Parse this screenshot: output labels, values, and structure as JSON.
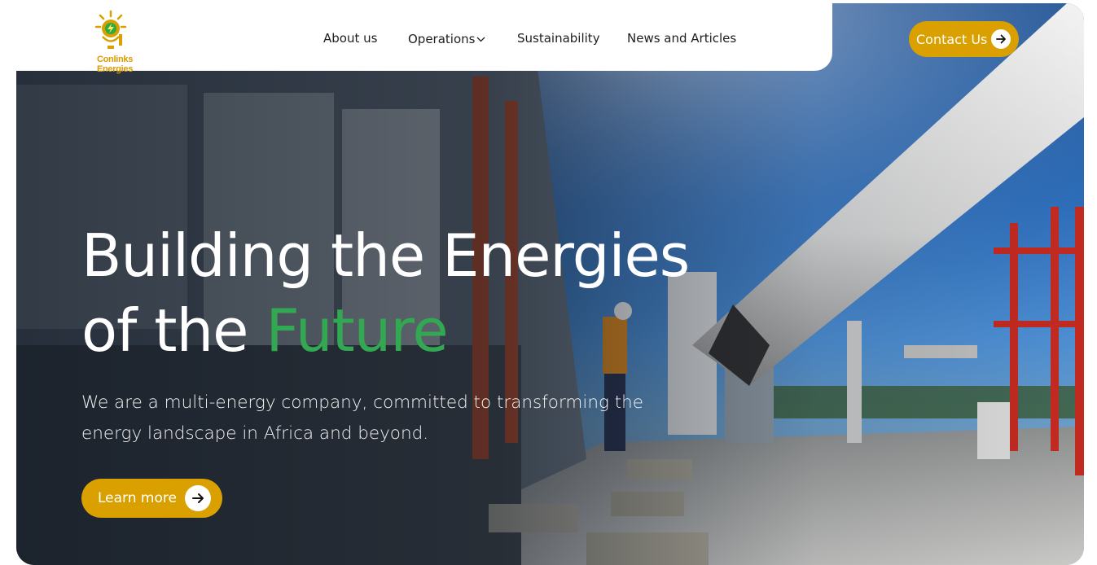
{
  "brand": {
    "name": "Conlinks Energies"
  },
  "nav": {
    "items": [
      {
        "label": "About us"
      },
      {
        "label": "Operations"
      },
      {
        "label": "Sustainability"
      },
      {
        "label": "News and Articles"
      }
    ],
    "contact_label": "Contact Us"
  },
  "hero": {
    "headline_line1": "Building the Energies",
    "headline_line2_prefix": "of the ",
    "headline_highlight": "Future",
    "subtext": "We are a multi-energy company, committed to transforming the energy landscape in Africa and beyond.",
    "cta_label": "Learn more"
  },
  "colors": {
    "accent": "#d9a000",
    "highlight_green": "#33a852"
  },
  "icons": {
    "nav_dropdown": "chevron-down-icon",
    "contact_arrow": "arrow-right-icon",
    "learn_arrow": "arrow-right-icon",
    "logo": "sun-lightning-logo"
  }
}
